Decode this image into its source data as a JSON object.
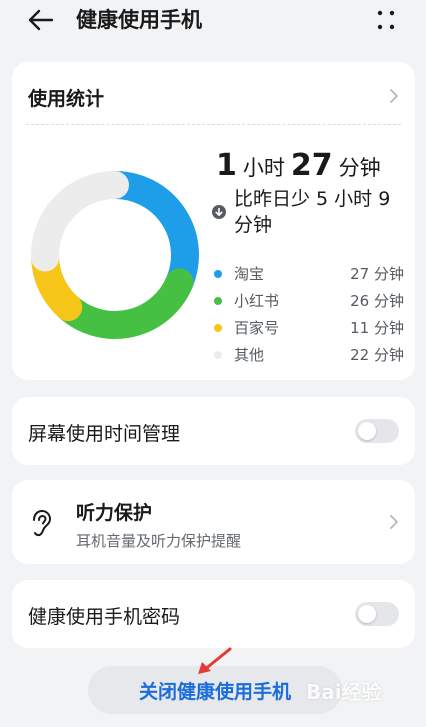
{
  "header": {
    "title": "健康使用手机",
    "back_icon": "arrow-left-icon",
    "more_icon": "more-vertical-icon"
  },
  "usage_stats": {
    "title": "使用统计",
    "total": {
      "hours": "1",
      "hours_unit": "小时",
      "minutes": "27",
      "minutes_unit": "分钟"
    },
    "compare_text": "比昨日少 5 小时 9 分钟",
    "compare_icon": "arrow-down-circle-icon",
    "apps": [
      {
        "name": "淘宝",
        "value": "27 分钟",
        "minutes": 27,
        "color": "#1e9ee8"
      },
      {
        "name": "小红书",
        "value": "26 分钟",
        "minutes": 26,
        "color": "#45c043"
      },
      {
        "name": "百家号",
        "value": "11 分钟",
        "minutes": 11,
        "color": "#f5c518"
      },
      {
        "name": "其他",
        "value": "22 分钟",
        "minutes": 22,
        "color": "#ececec"
      }
    ]
  },
  "screen_time": {
    "label": "屏幕使用时间管理",
    "enabled": false
  },
  "hearing": {
    "title": "听力保护",
    "subtitle": "耳机音量及听力保护提醒",
    "icon": "ear-icon"
  },
  "password": {
    "label": "健康使用手机密码",
    "enabled": false
  },
  "close_button": {
    "label": "关闭健康使用手机"
  },
  "watermark": {
    "text": "Bai经验"
  },
  "colors": {
    "accent": "#1a6ddb",
    "background": "#f1f3f5",
    "annotation": "#e53935"
  }
}
